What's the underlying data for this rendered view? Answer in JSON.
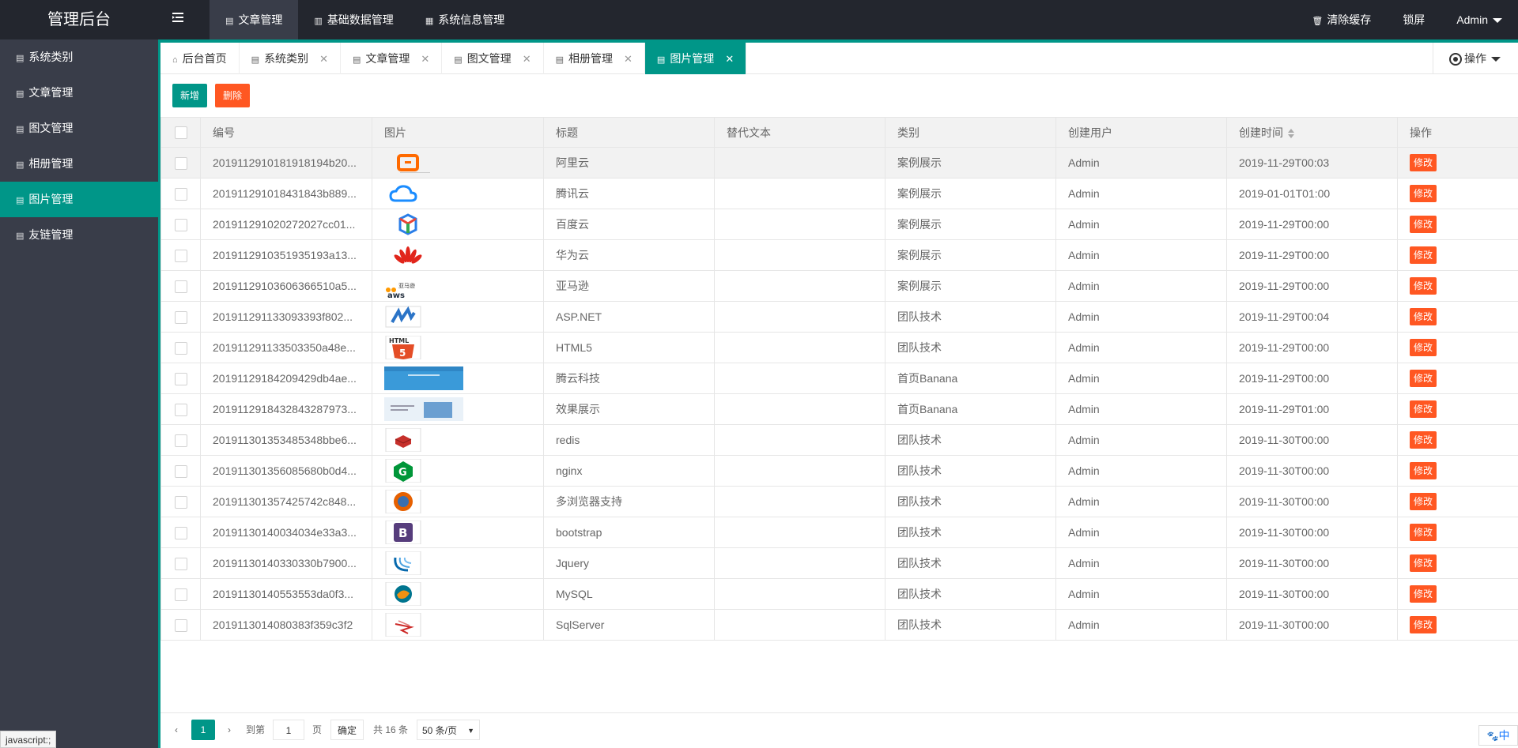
{
  "app": {
    "title": "管理后台",
    "toggle_icon": "menu-toggle-icon"
  },
  "top_nav": [
    {
      "label": "文章管理",
      "icon": "document-icon",
      "active": true
    },
    {
      "label": "基础数据管理",
      "icon": "database-icon",
      "active": false
    },
    {
      "label": "系统信息管理",
      "icon": "grid-icon",
      "active": false
    }
  ],
  "top_right": {
    "clear_cache": "清除缓存",
    "lock": "锁屏",
    "user": "Admin"
  },
  "sidebar": [
    {
      "label": "系统类别",
      "active": false
    },
    {
      "label": "文章管理",
      "active": false
    },
    {
      "label": "图文管理",
      "active": false
    },
    {
      "label": "相册管理",
      "active": false
    },
    {
      "label": "图片管理",
      "active": true
    },
    {
      "label": "友链管理",
      "active": false
    }
  ],
  "tabs": [
    {
      "label": "后台首页",
      "closable": false,
      "active": false
    },
    {
      "label": "系统类别",
      "closable": true,
      "active": false
    },
    {
      "label": "文章管理",
      "closable": true,
      "active": false
    },
    {
      "label": "图文管理",
      "closable": true,
      "active": false
    },
    {
      "label": "相册管理",
      "closable": true,
      "active": false
    },
    {
      "label": "图片管理",
      "closable": true,
      "active": true
    }
  ],
  "tab_ops_label": "操作",
  "toolbar": {
    "add": "新增",
    "delete": "删除"
  },
  "table": {
    "headers": [
      "编号",
      "图片",
      "标题",
      "替代文本",
      "类别",
      "创建用户",
      "创建时间",
      "操作"
    ],
    "edit_label": "修改",
    "rows": [
      {
        "id": "201911291018191819­4b20...",
        "img": "aliyun",
        "title": "阿里云",
        "alt": "",
        "category": "案例展示",
        "user": "Admin",
        "time": "2019-11-29T00:03"
      },
      {
        "id": "20191129101843184 3b889...",
        "img": "tencent",
        "title": "腾讯云",
        "alt": "",
        "category": "案例展示",
        "user": "Admin",
        "time": "2019-01-01T01:00"
      },
      {
        "id": "20191129102027202 7cc01...",
        "img": "baidu",
        "title": "百度云",
        "alt": "",
        "category": "案例展示",
        "user": "Admin",
        "time": "2019-11-29T00:00"
      },
      {
        "id": "20191129103519351 93a13...",
        "img": "huawei",
        "title": "华为云",
        "alt": "",
        "category": "案例展示",
        "user": "Admin",
        "time": "2019-11-29T00:00"
      },
      {
        "id": "20191129103606366 510a5...",
        "img": "aws",
        "title": "亚马逊",
        "alt": "",
        "category": "案例展示",
        "user": "Admin",
        "time": "2019-11-29T00:00"
      },
      {
        "id": "20191129113309339 3f802...",
        "img": "aspnet",
        "title": "ASP.NET",
        "alt": "",
        "category": "团队技术",
        "user": "Admin",
        "time": "2019-11-29T00:04"
      },
      {
        "id": "20191129113350335 0a48e...",
        "img": "html5",
        "title": "HTML5",
        "alt": "",
        "category": "团队技术",
        "user": "Admin",
        "time": "2019-11-29T00:00"
      },
      {
        "id": "20191129184209429 db4ae...",
        "img": "banner1",
        "title": "腾云科技",
        "alt": "",
        "category": "首页Banana",
        "user": "Admin",
        "time": "2019-11-29T00:00"
      },
      {
        "id": "20191129184328432 87973...",
        "img": "banner2",
        "title": "效果展示",
        "alt": "",
        "category": "首页Banana",
        "user": "Admin",
        "time": "2019-11-29T01:00"
      },
      {
        "id": "20191130135348534 8bbe6...",
        "img": "redis",
        "title": "redis",
        "alt": "",
        "category": "团队技术",
        "user": "Admin",
        "time": "2019-11-30T00:00"
      },
      {
        "id": "20191130135608568 0b0d4...",
        "img": "nginx",
        "title": "nginx",
        "alt": "",
        "category": "团队技术",
        "user": "Admin",
        "time": "2019-11-30T00:00"
      },
      {
        "id": "20191130135742574 2c848...",
        "img": "firefox",
        "title": "多浏览器支持",
        "alt": "",
        "category": "团队技术",
        "user": "Admin",
        "time": "2019-11-30T00:00"
      },
      {
        "id": "20191130140034034 e33a3...",
        "img": "bootstrap",
        "title": "bootstrap",
        "alt": "",
        "category": "团队技术",
        "user": "Admin",
        "time": "2019-11-30T00:00"
      },
      {
        "id": "20191130140330330 b7900...",
        "img": "jquery",
        "title": "Jquery",
        "alt": "",
        "category": "团队技术",
        "user": "Admin",
        "time": "2019-11-30T00:00"
      },
      {
        "id": "20191130140553553 da0f3...",
        "img": "mysql",
        "title": "MySQL",
        "alt": "",
        "category": "团队技术",
        "user": "Admin",
        "time": "2019-11-30T00:00"
      },
      {
        "id": "20191130140803 83f359c3f2",
        "img": "sqlserver",
        "title": "SqlServer",
        "alt": "",
        "category": "团队技术",
        "user": "Admin",
        "time": "2019-11-30T00:00"
      }
    ]
  },
  "pagination": {
    "current": "1",
    "goto_label": "到第",
    "page_value": "1",
    "page_unit": "页",
    "confirm": "确定",
    "total": "共 16 条",
    "page_size": "50 条/页"
  },
  "status_tip": "javascript:;",
  "corner_widget": "中"
}
